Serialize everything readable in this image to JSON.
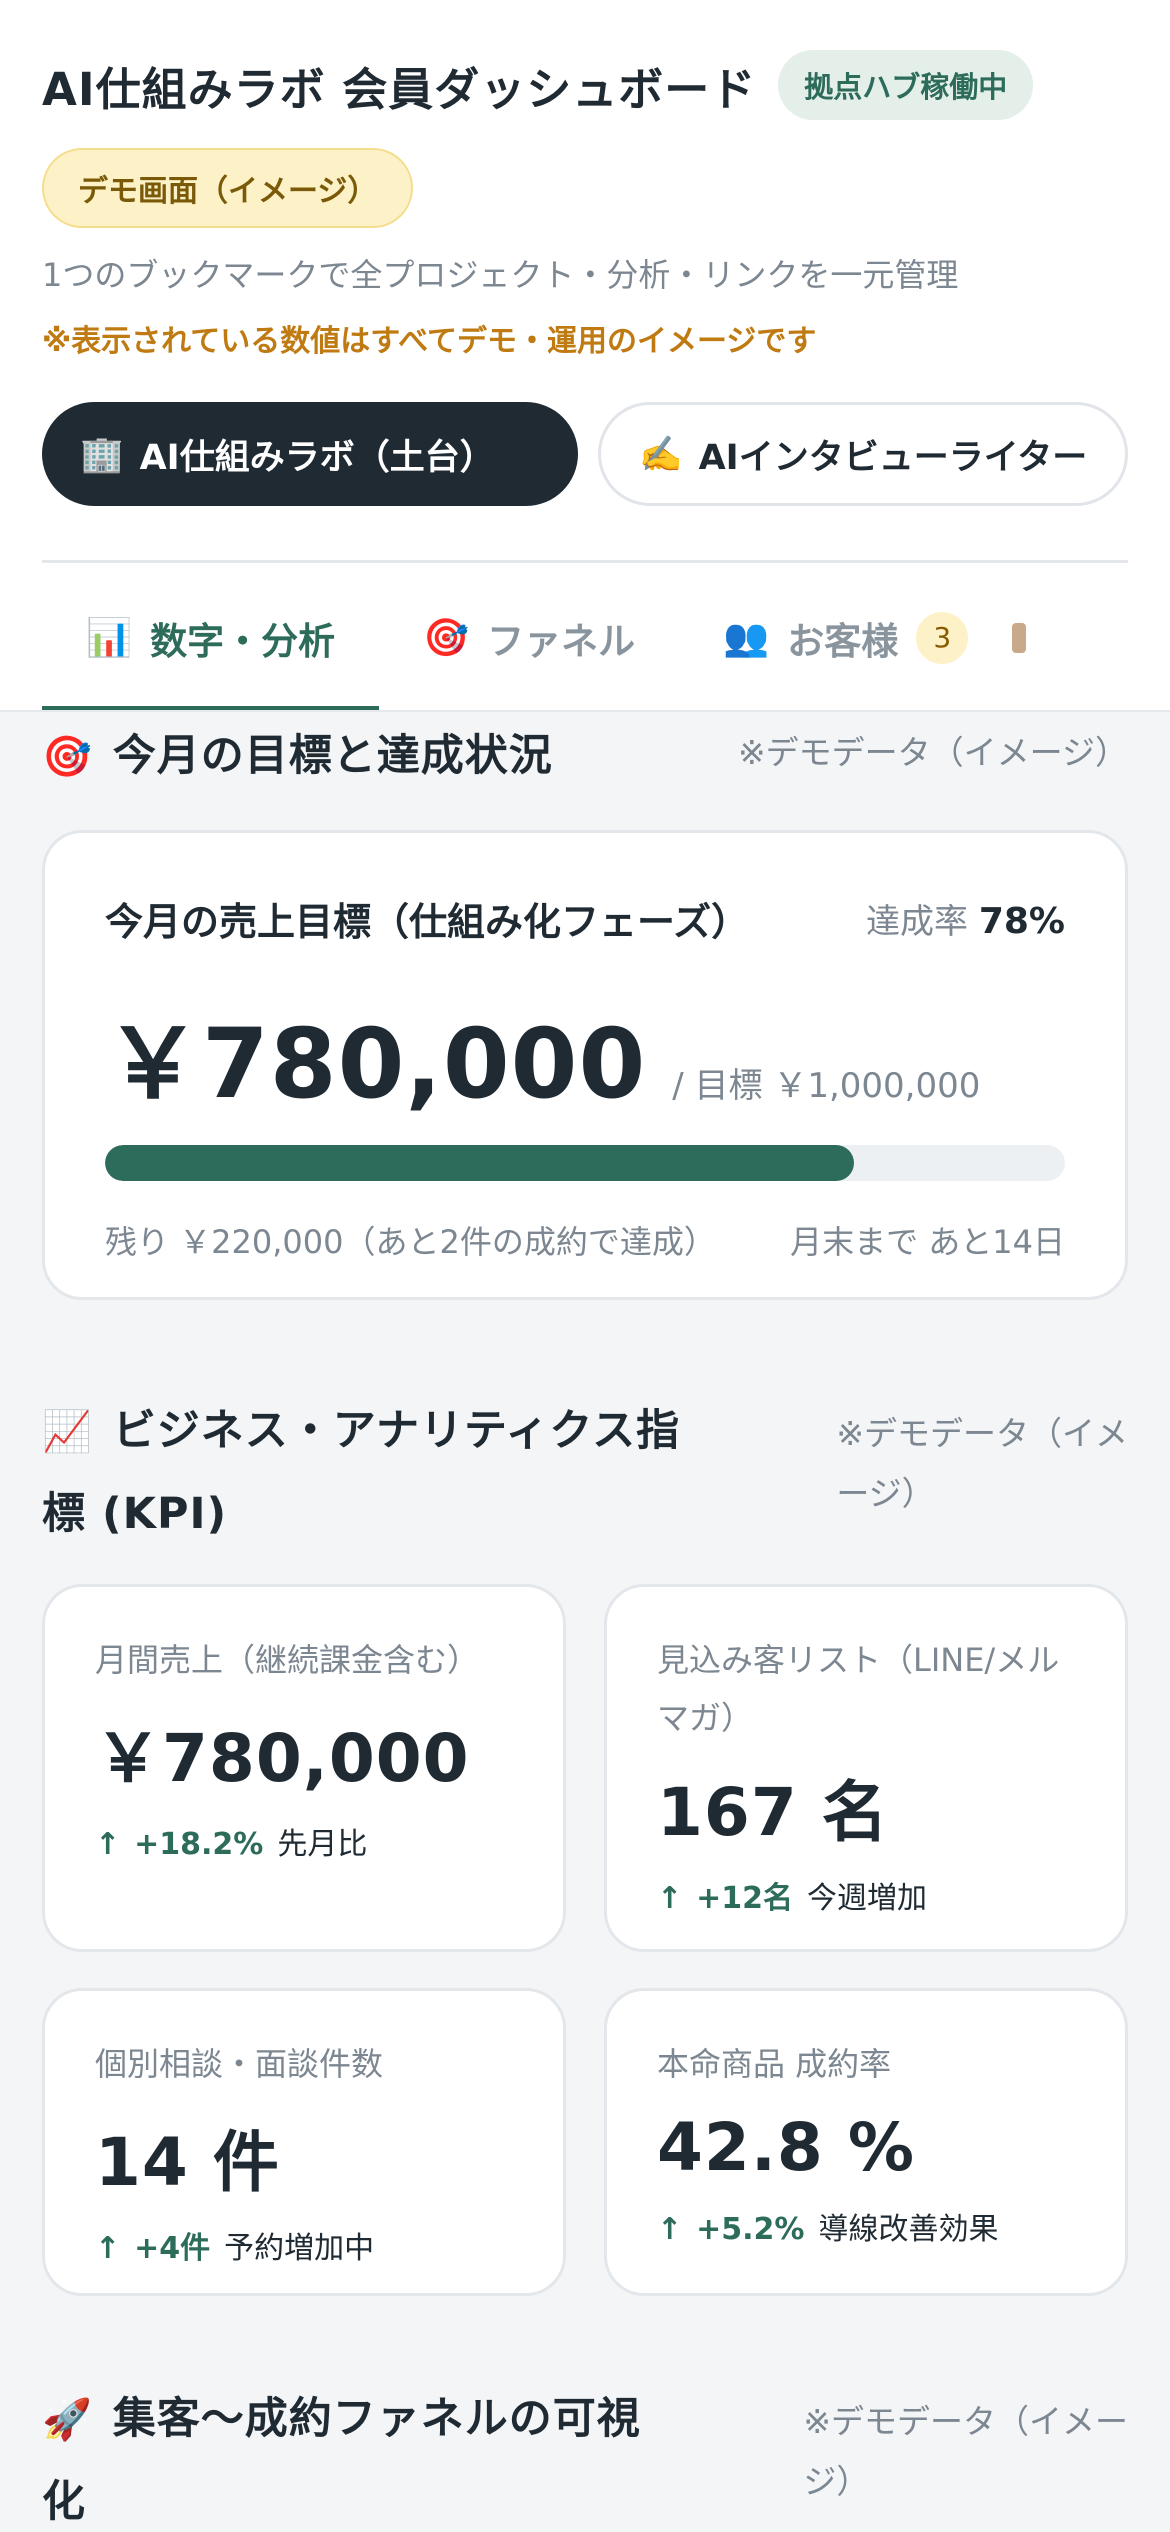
{
  "header": {
    "title": "AI仕組みラボ 会員ダッシュボード",
    "hub_badge": "拠点ハブ稼働中",
    "demo_badge": "デモ画面（イメージ）",
    "subtitle": "1つのブックマークで全プロジェクト・分析・リンクを一元管理",
    "notice": "※表示されている数値はすべてデモ・運用のイメージです"
  },
  "projects": [
    {
      "icon": "🏢",
      "label": "AI仕組みラボ（土台）",
      "active": true
    },
    {
      "icon": "✍️",
      "label": "AIインタビューライター",
      "active": false
    }
  ],
  "tabs": [
    {
      "icon": "📊",
      "label": "数字・分析",
      "active": true
    },
    {
      "icon": "🎯",
      "label": "ファネル",
      "active": false
    },
    {
      "icon": "👥",
      "label": "お客様",
      "count": "3",
      "active": false
    }
  ],
  "goal_section": {
    "icon": "🎯",
    "title": "今月の目標と達成状況",
    "note": "※デモデータ（イメージ）",
    "card": {
      "label": "今月の売上目標（仕組み化フェーズ）",
      "rate_label": "達成率",
      "rate_value": "78%",
      "progress": 0.78,
      "amount": "￥780,000",
      "target": "/ 目標 ￥1,000,000",
      "remaining": "残り ￥220,000（あと2件の成約で達成）",
      "days_left": "月末まで あと14日"
    }
  },
  "kpi_section": {
    "icon": "📈",
    "title_line1": "ビジネス・アナリティクス指",
    "title_line2": "標 (KPI)",
    "note_line1": "※デモデータ（イメ",
    "note_line2": "ージ）",
    "cards": [
      {
        "label": "月間売上（継続課金含む）",
        "value": "￥780,000",
        "delta": "+18.2%",
        "delta_text": "先月比"
      },
      {
        "label": "見込み客リスト（LINE/メルマガ）",
        "value": "167 名",
        "delta": "+12名",
        "delta_text": "今週増加"
      },
      {
        "label": "個別相談・面談件数",
        "value": "14 件",
        "delta": "+4件",
        "delta_text": "予約増加中"
      },
      {
        "label": "本命商品 成約率",
        "value": "42.8 %",
        "delta": "+5.2%",
        "delta_text": "導線改善効果"
      }
    ]
  },
  "funnel_section": {
    "icon": "🚀",
    "title_line1": "集客〜成約ファネルの可視",
    "title_line2": "化",
    "note_line1": "※デモデータ（イメー",
    "note_line2": "ジ）"
  },
  "colors": {
    "accent": "#2d6b5a",
    "dark": "#1f2a33",
    "warning": "#c07a12",
    "demo_bg": "#fdf1c7"
  }
}
